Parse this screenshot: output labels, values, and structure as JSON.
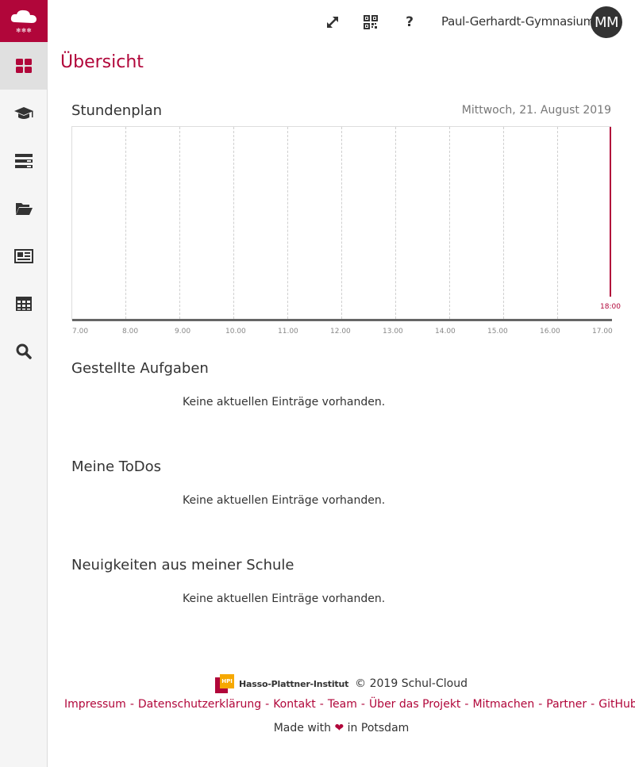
{
  "header": {
    "school_name": "Paul-Gerhardt-Gymnasium",
    "avatar_initials": "MM"
  },
  "sidebar": {
    "items": [
      {
        "icon": "dashboard-icon",
        "active": true
      },
      {
        "icon": "graduation-cap-icon"
      },
      {
        "icon": "tasks-icon"
      },
      {
        "icon": "folder-open-icon"
      },
      {
        "icon": "newspaper-icon"
      },
      {
        "icon": "table-icon"
      },
      {
        "icon": "search-icon"
      }
    ]
  },
  "page": {
    "title": "Übersicht"
  },
  "schedule": {
    "title": "Stundenplan",
    "date": "Mittwoch, 21. August 2019",
    "ticks": [
      "7.00",
      "8.00",
      "9.00",
      "10.00",
      "11.00",
      "12.00",
      "13.00",
      "14.00",
      "15.00",
      "16.00",
      "17.00"
    ],
    "now_label": "18:00"
  },
  "sections": [
    {
      "title": "Gestellte Aufgaben",
      "empty_text": "Keine aktuellen Einträge vorhanden."
    },
    {
      "title": "Meine ToDos",
      "empty_text": "Keine aktuellen Einträge vorhanden."
    },
    {
      "title": "Neuigkeiten aus meiner Schule",
      "empty_text": "Keine aktuellen Einträge vorhanden."
    }
  ],
  "footer": {
    "hpi_text": "Hasso-Plattner-Institut",
    "hpi_mark": "HPI",
    "copyright": "© 2019 Schul-Cloud",
    "links": [
      "Impressum",
      "Datenschutzerklärung",
      "Kontakt",
      "Team",
      "Über das Projekt",
      "Mitmachen",
      "Partner",
      "GitHub"
    ],
    "made_with_before": "Made with",
    "made_with_after": "in Potsdam"
  },
  "colors": {
    "brand": "#b1063a",
    "sidebar_bg": "#f5f5f5"
  }
}
